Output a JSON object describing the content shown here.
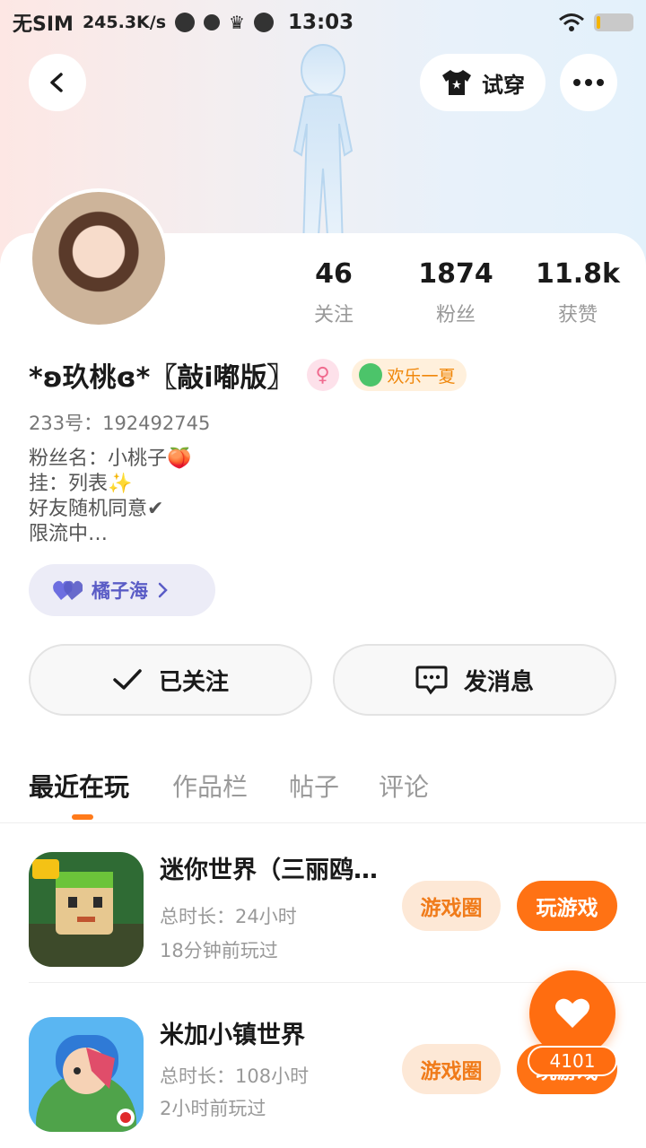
{
  "status_bar": {
    "carrier": "无SIM",
    "speed": "245.3K/s",
    "time": "13:03"
  },
  "header": {
    "tryon_label": "试穿"
  },
  "profile": {
    "stats": [
      {
        "value": "46",
        "label": "关注"
      },
      {
        "value": "1874",
        "label": "粉丝"
      },
      {
        "value": "11.8k",
        "label": "获赞"
      }
    ],
    "name": "*ʚ玖桃ɞ*〖敲i嘟版〗",
    "gender_symbol": "♀",
    "badge_label": "欢乐一夏",
    "uid": "233号：192492745",
    "bio_lines": [
      "粉丝名：小桃子🍑",
      "挂：列表✨",
      "好友随机同意✔",
      "限流中…"
    ],
    "club_label": "橘子海"
  },
  "actions": {
    "follow_label": "已关注",
    "message_label": "发消息"
  },
  "tabs": [
    {
      "label": "最近在玩",
      "active": true
    },
    {
      "label": "作品栏",
      "active": false
    },
    {
      "label": "帖子",
      "active": false
    },
    {
      "label": "评论",
      "active": false
    }
  ],
  "games": [
    {
      "title": "迷你世界（三丽鸥联动）",
      "duration": "总时长：24小时",
      "last_played": "18分钟前玩过",
      "circle_label": "游戏圈",
      "play_label": "玩游戏"
    },
    {
      "title": "米加小镇世界",
      "duration": "总时长：108小时",
      "last_played": "2小时前玩过",
      "circle_label": "游戏圈",
      "play_label": "玩游戏"
    }
  ],
  "like_count": "4101",
  "colors": {
    "accent": "#ff7214",
    "club": "#5a5cc6"
  }
}
